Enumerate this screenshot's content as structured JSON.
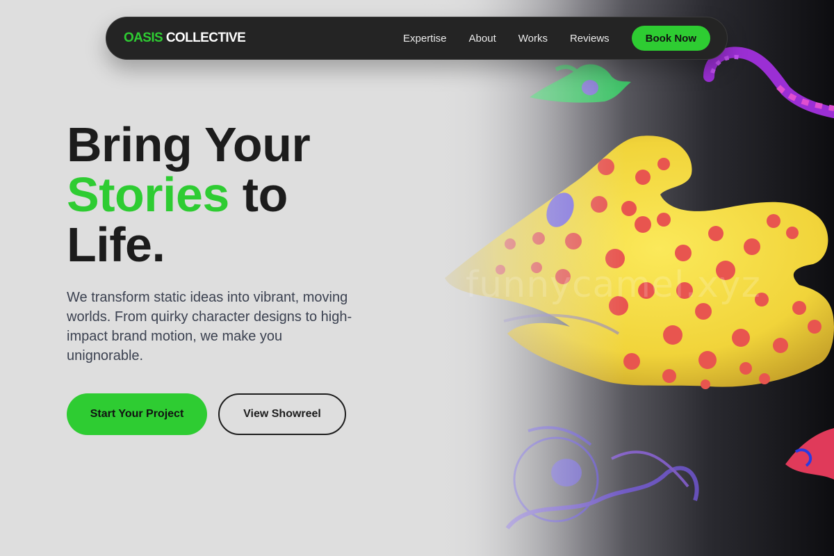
{
  "brand": {
    "part1": "OASIS",
    "part2": "COLLECTIVE"
  },
  "nav": {
    "links": [
      "Expertise",
      "About",
      "Works",
      "Reviews"
    ],
    "cta": "Book Now"
  },
  "hero": {
    "title_line1": "Bring Your",
    "title_highlight": "Stories",
    "title_after_highlight": " to",
    "title_line3": "Life.",
    "subtitle": "We transform static ideas into vibrant, moving worlds. From quirky character designs to high-impact brand motion, we make you unignorable.",
    "primary_cta": "Start Your Project",
    "secondary_cta": "View Showreel",
    "watermark": "funnycamel.xyz"
  },
  "colors": {
    "accent": "#2ecc32",
    "nav_bg": "#242424",
    "page_bg": "#dedede",
    "text_dark": "#1c1c1c",
    "text_muted": "#3b4150"
  }
}
